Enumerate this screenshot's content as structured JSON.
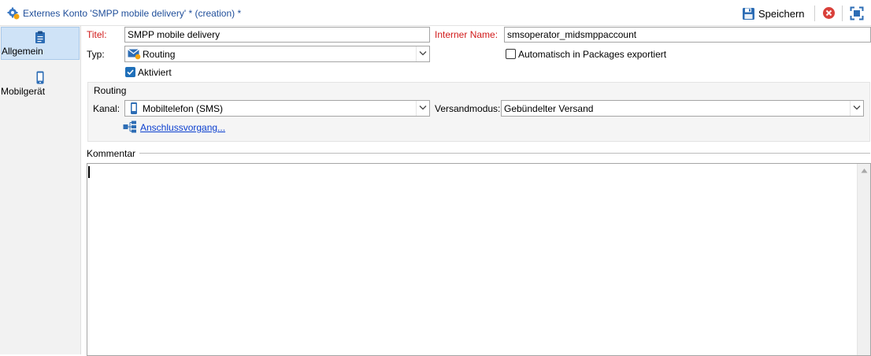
{
  "window": {
    "title": "Externes Konto  'SMPP mobile delivery' * (creation) *",
    "save_label": "Speichern"
  },
  "sidebar": {
    "items": [
      {
        "label": "Allgemein",
        "icon": "clipboard-icon",
        "active": true
      },
      {
        "label": "Mobilgerät",
        "icon": "mobile-phone-icon",
        "active": false
      }
    ]
  },
  "form": {
    "title_label": "Titel:",
    "title_value": "SMPP mobile delivery",
    "internal_name_label": "Interner Name:",
    "internal_name_value": "smsoperator_midsmppaccount",
    "type_label": "Typ:",
    "type_value": "Routing",
    "auto_export_label": "Automatisch in Packages exportiert",
    "auto_export_checked": false,
    "activated_label": "Aktiviert",
    "activated_checked": true
  },
  "routing": {
    "group_label": "Routing",
    "channel_label": "Kanal:",
    "channel_value": "Mobiltelefon (SMS)",
    "mode_label": "Versandmodus:",
    "mode_value": "Gebündelter Versand",
    "connection_link": "Anschlussvorgang..."
  },
  "comment": {
    "label": "Kommentar",
    "value": ""
  },
  "colors": {
    "required_label": "#d11a1a",
    "title_text": "#1f4e9a",
    "link": "#0b3fcf",
    "checkbox_accent": "#1f6fb9",
    "active_nav_bg": "#cfe3f7"
  }
}
